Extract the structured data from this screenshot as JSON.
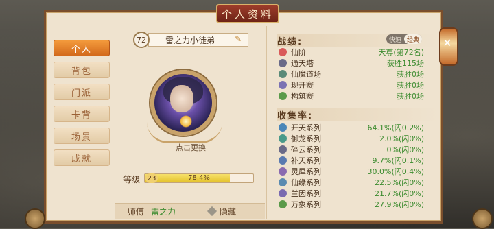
{
  "title": "个人资料",
  "sidebar": {
    "items": [
      {
        "label": "个人",
        "active": true
      },
      {
        "label": "背包",
        "active": false
      },
      {
        "label": "门派",
        "active": false
      },
      {
        "label": "卡背",
        "active": false
      },
      {
        "label": "场景",
        "active": false
      },
      {
        "label": "成就",
        "active": false
      }
    ]
  },
  "profile": {
    "level_badge": "72",
    "name": "雷之力小徒弟",
    "change_avatar_label": "点击更换",
    "level_label": "等级",
    "level_value": "23",
    "progress_text": "78.4%",
    "progress": 0.784,
    "master_label": "师傅",
    "master_name": "雷之力",
    "hide_label": "隐藏"
  },
  "record": {
    "title": "战绩:",
    "toggle": [
      "快速",
      "经典"
    ],
    "selected_toggle": "经典",
    "items": [
      {
        "label": "仙阶",
        "value": "天尊(第72名)",
        "icon": "immortal-icon",
        "color": "#d95a5a"
      },
      {
        "label": "通天塔",
        "value": "获胜115场",
        "icon": "tower-icon",
        "color": "#6a6a88"
      },
      {
        "label": "仙魔道场",
        "value": "获胜0场",
        "icon": "arena-icon",
        "color": "#5a8a78"
      },
      {
        "label": "现开赛",
        "value": "获胜0场",
        "icon": "open-icon",
        "color": "#7b72b3"
      },
      {
        "label": "构筑赛",
        "value": "获胜0场",
        "icon": "build-icon",
        "color": "#5a9a4a"
      }
    ]
  },
  "collection": {
    "title": "收集率:",
    "items": [
      {
        "label": "开天系列",
        "value": "64.1%(闪0.2%)",
        "icon": "kaitian-icon",
        "color": "#4a86b8"
      },
      {
        "label": "御龙系列",
        "value": "2.0%(闪0%)",
        "icon": "dragon-icon",
        "color": "#4a9a8a"
      },
      {
        "label": "碎云系列",
        "value": "0%(闪0%)",
        "icon": "cloud-icon",
        "color": "#6a6a88"
      },
      {
        "label": "补天系列",
        "value": "9.7%(闪0.1%)",
        "icon": "butian-icon",
        "color": "#5a7ab0"
      },
      {
        "label": "灵犀系列",
        "value": "30.0%(闪0.4%)",
        "icon": "lingxi-icon",
        "color": "#8a6ab0"
      },
      {
        "label": "仙缘系列",
        "value": "22.5%(闪0%)",
        "icon": "xianyuan-icon",
        "color": "#5a8ab0"
      },
      {
        "label": "兰因系列",
        "value": "21.7%(闪0%)",
        "icon": "lanyin-icon",
        "color": "#7a6ab0"
      },
      {
        "label": "万象系列",
        "value": "27.9%(闪0%)",
        "icon": "wanxiang-icon",
        "color": "#5a9a4a"
      }
    ]
  },
  "colors": {
    "accent": "#f39a3c",
    "success_text": "#3b8b2e",
    "frame": "#7a4e2c"
  }
}
